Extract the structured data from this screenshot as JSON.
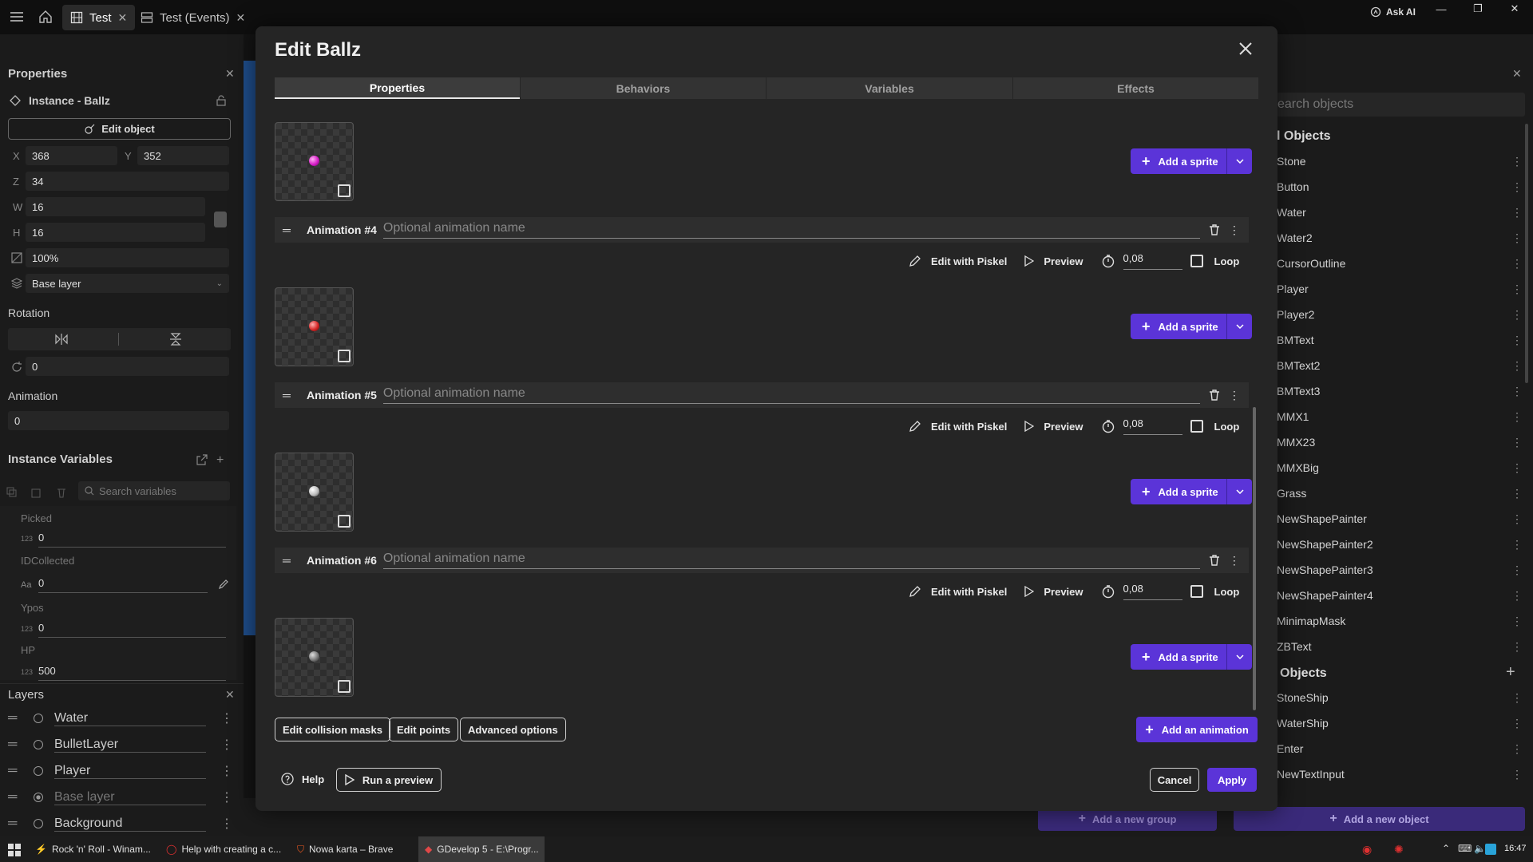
{
  "topbar": {
    "tabs": [
      {
        "label": "Test"
      },
      {
        "label": "Test (Events)"
      }
    ],
    "ask_ai": "Ask AI"
  },
  "properties_panel": {
    "title": "Properties",
    "instance_label": "Instance  -  Ballz",
    "edit_object": "Edit object",
    "x_label": "X",
    "x_value": "368",
    "y_label": "Y",
    "y_value": "352",
    "z_label": "Z",
    "z_value": "34",
    "w_label": "W",
    "w_value": "16",
    "h_label": "H",
    "h_value": "16",
    "opacity": "100%",
    "layer": "Base layer",
    "rotation_title": "Rotation",
    "angle": "0",
    "animation_title": "Animation",
    "animation_value": "0",
    "instance_variables_title": "Instance Variables",
    "search_placeholder": "Search variables",
    "variables": [
      {
        "name": "Picked",
        "type": "123",
        "value": "0"
      },
      {
        "name": "IDCollected",
        "type": "Aa",
        "value": "0"
      },
      {
        "name": "Ypos",
        "type": "123",
        "value": "0"
      },
      {
        "name": "HP",
        "type": "123",
        "value": "500"
      }
    ]
  },
  "layers_panel": {
    "title": "Layers",
    "layers": [
      "Water",
      "BulletLayer",
      "Player",
      "Base layer",
      "Background"
    ]
  },
  "objects_panel": {
    "search_placeholder": "earch objects",
    "scene_objects_title": "l Objects",
    "scene_objects": [
      "Stone",
      "Button",
      "Water",
      "Water2",
      "CursorOutline",
      "Player",
      "Player2",
      "BMText",
      "BMText2",
      "BMText3",
      "MMX1",
      "MMX23",
      "MMXBig",
      "Grass",
      "NewShapePainter",
      "NewShapePainter2",
      "NewShapePainter3",
      "NewShapePainter4",
      "MinimapMask",
      "ZBText"
    ],
    "global_objects_title": "Objects",
    "global_objects": [
      "StoneShip",
      "WaterShip",
      "Enter",
      "NewTextInput"
    ],
    "add_group": "Add a new group",
    "add_object": "Add a new object"
  },
  "dialog": {
    "title": "Edit Ballz",
    "tabs": [
      "Properties",
      "Behaviors",
      "Variables",
      "Effects"
    ],
    "animations": [
      {
        "label": "Animation #4",
        "placeholder": "Optional animation name",
        "timer": "0,08"
      },
      {
        "label": "Animation #5",
        "placeholder": "Optional animation name",
        "timer": "0,08"
      },
      {
        "label": "Animation #6",
        "placeholder": "Optional animation name",
        "timer": "0,08"
      }
    ],
    "sprite_colors": [
      "#d81ec8",
      "#d62828",
      "#cccccc",
      "#777777"
    ],
    "add_sprite": "Add a sprite",
    "edit_piskel": "Edit with Piskel",
    "preview": "Preview",
    "loop": "Loop",
    "edit_collision": "Edit collision masks",
    "edit_points": "Edit points",
    "advanced_options": "Advanced options",
    "add_animation": "Add an animation",
    "help": "Help",
    "run_preview": "Run a preview",
    "cancel": "Cancel",
    "apply": "Apply"
  },
  "taskbar": {
    "items": [
      "Rock 'n' Roll - Winam...",
      "Help with creating a c...",
      "Nowa karta – Brave",
      "GDevelop 5 - E:\\Progr..."
    ],
    "time": "16:47"
  },
  "colors": {
    "accent": "#5b34d8",
    "bg": "#141414",
    "panel": "#1b1b1b",
    "dialog": "#252525"
  }
}
